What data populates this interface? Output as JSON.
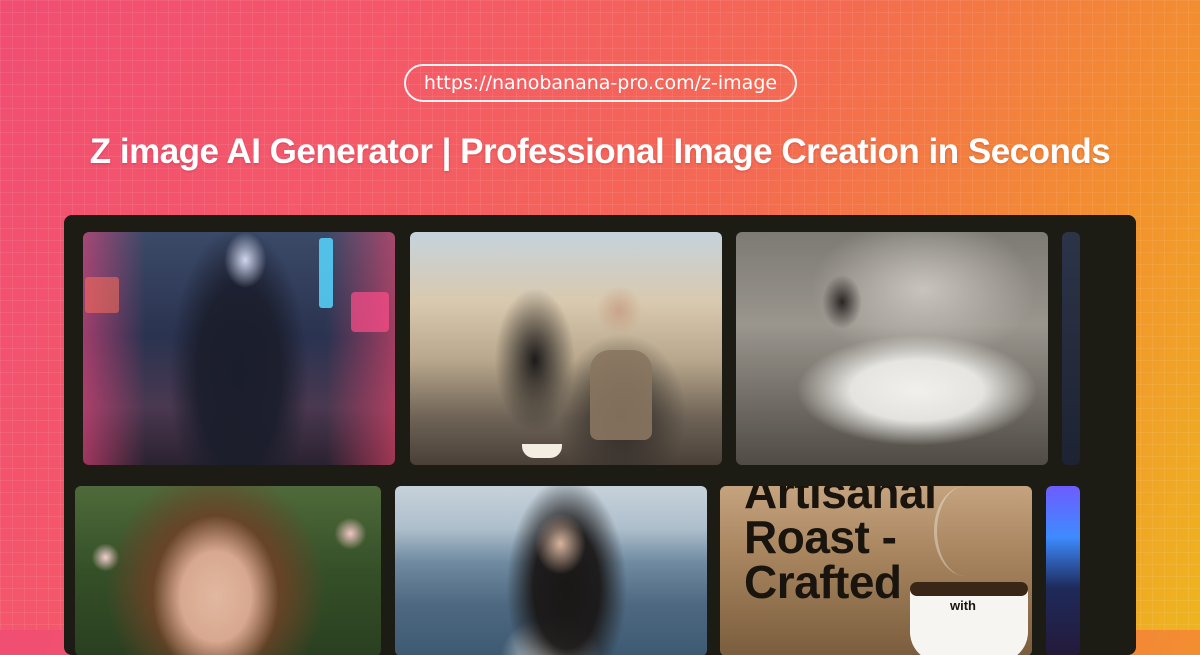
{
  "url": "https://nanobanana-pro.com/z-image",
  "headline": "Z image AI Generator | Professional Image Creation in Seconds",
  "gallery": {
    "ad_text": "Artisanal Roast - Crafted",
    "mug_text": "with"
  },
  "colors": {
    "gradient_start": "#f04e72",
    "gradient_end": "#eeb51f",
    "gallery_bg": "#1d1c14"
  }
}
